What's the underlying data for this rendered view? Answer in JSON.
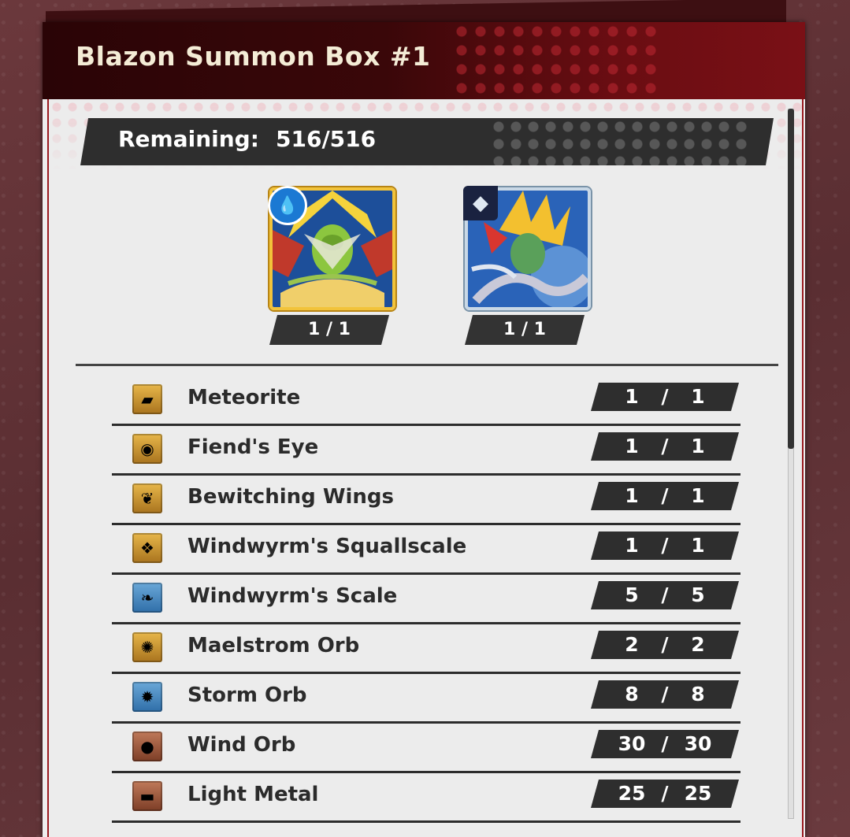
{
  "header": {
    "title": "Blazon Summon Box #1"
  },
  "remaining": {
    "label": "Remaining:",
    "value": "516/516"
  },
  "characters": [
    {
      "count": "1 / 1",
      "badge_icon": "water-drop-icon"
    },
    {
      "count": "1 / 1",
      "badge_icon": "diamond-icon"
    }
  ],
  "items": [
    {
      "name": "Meteorite",
      "current": "1",
      "total": "1",
      "icon": "meteorite-icon"
    },
    {
      "name": "Fiend's Eye",
      "current": "1",
      "total": "1",
      "icon": "fiends-eye-icon"
    },
    {
      "name": "Bewitching Wings",
      "current": "1",
      "total": "1",
      "icon": "wings-icon"
    },
    {
      "name": "Windwyrm's Squallscale",
      "current": "1",
      "total": "1",
      "icon": "squallscale-icon"
    },
    {
      "name": "Windwyrm's Scale",
      "current": "5",
      "total": "5",
      "icon": "scale-icon"
    },
    {
      "name": "Maelstrom Orb",
      "current": "2",
      "total": "2",
      "icon": "maelstrom-orb-icon"
    },
    {
      "name": "Storm Orb",
      "current": "8",
      "total": "8",
      "icon": "storm-orb-icon"
    },
    {
      "name": "Wind Orb",
      "current": "30",
      "total": "30",
      "icon": "wind-orb-icon"
    },
    {
      "name": "Light Metal",
      "current": "25",
      "total": "25",
      "icon": "light-metal-icon"
    }
  ],
  "separator": "/",
  "colors": {
    "header_dark": "#2a0406",
    "header_red": "#7a1016",
    "count_bg": "#2e2e2e",
    "gold_frame": "#f2c33a"
  }
}
